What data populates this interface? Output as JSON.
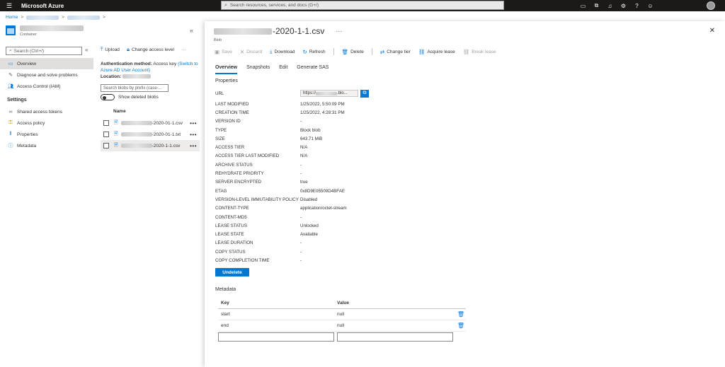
{
  "topbar": {
    "brand": "Microsoft Azure",
    "search_placeholder": "Search resources, services, and docs (G+/)"
  },
  "breadcrumb": {
    "home": "Home"
  },
  "resource": {
    "type_label": "Container"
  },
  "nav": {
    "search_placeholder": "Search (Ctrl+/)",
    "items": [
      {
        "label": "Overview",
        "icon": "container-icon"
      },
      {
        "label": "Diagnose and solve problems",
        "icon": "wrench-icon"
      },
      {
        "label": "Access Control (IAM)",
        "icon": "people-icon"
      }
    ],
    "settings_header": "Settings",
    "settings_items": [
      {
        "label": "Shared access tokens",
        "icon": "link-icon"
      },
      {
        "label": "Access policy",
        "icon": "key-icon"
      },
      {
        "label": "Properties",
        "icon": "properties-icon"
      },
      {
        "label": "Metadata",
        "icon": "info-icon"
      }
    ]
  },
  "list": {
    "upload_label": "Upload",
    "change_access_label": "Change access level",
    "auth_label": "Authentication method:",
    "auth_value": "Access key",
    "auth_link": "(Switch to Azure AD User Account)",
    "location_label": "Location:",
    "prefix_placeholder": "Search blobs by prefix (case-...",
    "show_deleted_label": "Show deleted blobs",
    "name_header": "Name",
    "files": [
      {
        "suffix": "-2020-01-1.csv"
      },
      {
        "suffix": "-2020-01-1.txt"
      },
      {
        "suffix": "-2020-1-1.csv"
      }
    ]
  },
  "panel": {
    "title_suffix": "-2020-1-1.csv",
    "subtitle": "Blob",
    "toolbar": {
      "save": "Save",
      "discard": "Discard",
      "download": "Download",
      "refresh": "Refresh",
      "delete": "Delete",
      "change_tier": "Change tier",
      "acquire_lease": "Acquire lease",
      "break_lease": "Break lease"
    },
    "tabs": [
      "Overview",
      "Snapshots",
      "Edit",
      "Generate SAS"
    ],
    "properties_header": "Properties",
    "url_label": "URL",
    "url_value": "https://",
    "url_value_tail": ".blo...",
    "properties": [
      {
        "k": "LAST MODIFIED",
        "v": "1/25/2022, 5:50:09 PM"
      },
      {
        "k": "CREATION TIME",
        "v": "1/25/2022, 4:28:31 PM"
      },
      {
        "k": "VERSION ID",
        "v": "-"
      },
      {
        "k": "TYPE",
        "v": "Block blob"
      },
      {
        "k": "SIZE",
        "v": "643.71 MiB"
      },
      {
        "k": "ACCESS TIER",
        "v": "N/A"
      },
      {
        "k": "ACCESS TIER LAST MODIFIED",
        "v": "N/A"
      },
      {
        "k": "ARCHIVE STATUS",
        "v": "-"
      },
      {
        "k": "REHYDRATE PRIORITY",
        "v": "-"
      },
      {
        "k": "SERVER ENCRYPTED",
        "v": "true"
      },
      {
        "k": "ETAG",
        "v": "0x8D9E05509D4BFAE"
      },
      {
        "k": "VERSION-LEVEL IMMUTABILITY POLICY",
        "v": "Disabled"
      },
      {
        "k": "CONTENT-TYPE",
        "v": "application/octet-stream"
      },
      {
        "k": "CONTENT-MD5",
        "v": "-"
      },
      {
        "k": "LEASE STATUS",
        "v": "Unlocked"
      },
      {
        "k": "LEASE STATE",
        "v": "Available"
      },
      {
        "k": "LEASE DURATION",
        "v": "-"
      },
      {
        "k": "COPY STATUS",
        "v": "-"
      },
      {
        "k": "COPY COMPLETION TIME",
        "v": "-"
      }
    ],
    "undelete_label": "Undelete",
    "metadata_header": "Metadata",
    "metadata_key_header": "Key",
    "metadata_value_header": "Value",
    "metadata": [
      {
        "k": "start",
        "v": "null"
      },
      {
        "k": "end",
        "v": "null"
      }
    ]
  }
}
